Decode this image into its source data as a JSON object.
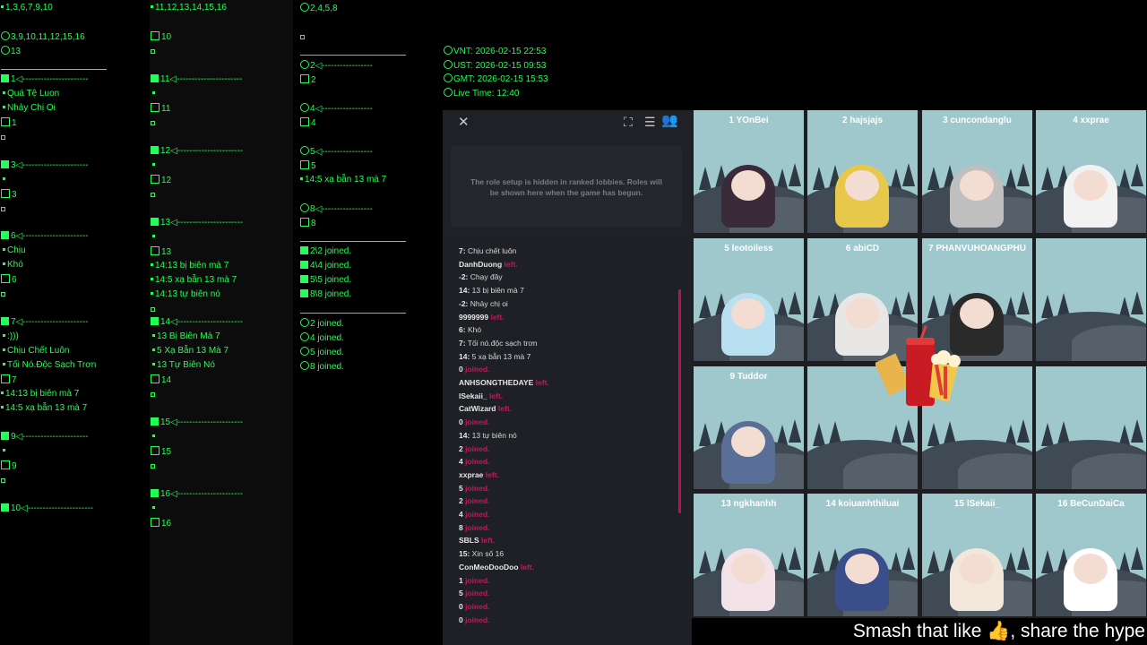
{
  "col1": {
    "header": "1,3,6,7,9,10",
    "list_line": "3,9,10,11,12,15,16",
    "count_line": "13",
    "sections": [
      {
        "id": "1",
        "lines": [
          "Quá Tệ Luon",
          "Nhảy Chị Oi"
        ],
        "box": "1"
      },
      {
        "id": "3",
        "lines": [],
        "box": "3"
      },
      {
        "id": "6",
        "lines": [
          "Chịu",
          "Khó"
        ],
        "box": "6"
      },
      {
        "id": "7",
        "lines": [
          ":)))",
          "Chịu Chết Luôn",
          "Tối Nó.Độc Sạch Trơn"
        ],
        "box": "7",
        "extra": [
          "14:13 bị biên mà 7",
          "14:5 xạ bẫn 13 mà 7"
        ]
      },
      {
        "id": "9",
        "lines": [],
        "box": "9"
      },
      {
        "id": "10",
        "lines": [],
        "box": ""
      }
    ]
  },
  "col2": {
    "header": "11,12,13,14,15,16",
    "box10": "10",
    "sections": [
      {
        "id": "11",
        "box": "11",
        "lines": []
      },
      {
        "id": "12",
        "box": "12",
        "lines": []
      },
      {
        "id": "13",
        "box": "13",
        "lines": [
          "14:13 bị biên mà 7",
          "14:5 xạ bẫn 13 mà 7",
          "14:13 tự biên nó"
        ]
      },
      {
        "id": "14",
        "box": "14",
        "lines": [
          "13 Bị Biên Mà 7",
          "5 Xạ Bẫn 13 Mà 7",
          "13 Tự Biên Nó"
        ]
      },
      {
        "id": "15",
        "box": "15",
        "lines": []
      },
      {
        "id": "16",
        "box": "16",
        "lines": []
      }
    ]
  },
  "col3": {
    "header": "2,4,5,8",
    "sections": [
      {
        "id": "2",
        "box": "2",
        "lines": []
      },
      {
        "id": "4",
        "box": "4",
        "lines": []
      },
      {
        "id": "5",
        "box": "5",
        "lines": [
          "14:5 xạ bẫn 13 mà 7"
        ]
      },
      {
        "id": "8",
        "box": "8",
        "lines": []
      }
    ],
    "joined_filled": [
      "2\\2 joined.",
      "4\\4 joined.",
      "5\\5 joined.",
      "8\\8 joined."
    ],
    "joined_icon": [
      "2 joined.",
      "4 joined.",
      "5 joined.",
      "8 joined."
    ]
  },
  "times": {
    "vnt": "VNT: 2026-02-15 22:53",
    "ust": "UST: 2026-02-15 09:53",
    "gmt": "GMT: 2026-02-15 15:53",
    "live": "Live Time: 12:40"
  },
  "sidebar": {
    "role_text": "The role setup is hidden in ranked lobbies. Roles will be shown here when the game has begun."
  },
  "chat": [
    {
      "name": "7:",
      "text": "Chịu chết luôn",
      "ev": ""
    },
    {
      "name": "DanhDuong",
      "text": "",
      "ev": "left."
    },
    {
      "name": "-2:",
      "text": "Chạy đây",
      "ev": ""
    },
    {
      "name": "14:",
      "text": "13 bị biên mà 7",
      "ev": ""
    },
    {
      "name": "-2:",
      "text": "Nhảy chị oi",
      "ev": ""
    },
    {
      "name": "9999999",
      "text": "",
      "ev": "left."
    },
    {
      "name": "6:",
      "text": "Khó",
      "ev": ""
    },
    {
      "name": "7:",
      "text": "Tối nó.độc sạch trơn",
      "ev": ""
    },
    {
      "name": "14:",
      "text": "5 xạ bẫn 13 mà 7",
      "ev": ""
    },
    {
      "name": "0",
      "text": "",
      "ev": "joined."
    },
    {
      "name": "ANHSONGTHEDAYE",
      "text": "",
      "ev": "left."
    },
    {
      "name": "lSekaii_",
      "text": "",
      "ev": "left."
    },
    {
      "name": "CatWizard",
      "text": "",
      "ev": "left."
    },
    {
      "name": "0",
      "text": "",
      "ev": "joined."
    },
    {
      "name": "14:",
      "text": "13 tự biên nó",
      "ev": ""
    },
    {
      "name": "2",
      "text": "",
      "ev": "joined."
    },
    {
      "name": "4",
      "text": "",
      "ev": "joined."
    },
    {
      "name": "xxprae",
      "text": "",
      "ev": "left."
    },
    {
      "name": "5",
      "text": "",
      "ev": "joined."
    },
    {
      "name": "2",
      "text": "",
      "ev": "joined."
    },
    {
      "name": "4",
      "text": "",
      "ev": "joined."
    },
    {
      "name": "8",
      "text": "",
      "ev": "joined."
    },
    {
      "name": "SBLS",
      "text": "",
      "ev": "left."
    },
    {
      "name": "15:",
      "text": "Xin số 16",
      "ev": ""
    },
    {
      "name": "ConMeoDooDoo",
      "text": "",
      "ev": "left."
    },
    {
      "name": "1",
      "text": "",
      "ev": "joined."
    },
    {
      "name": "5",
      "text": "",
      "ev": "joined."
    },
    {
      "name": "0",
      "text": "",
      "ev": "joined."
    },
    {
      "name": "0",
      "text": "",
      "ev": "joined."
    }
  ],
  "players": [
    {
      "label": "1 YOnBei",
      "color": "#3a2a3a"
    },
    {
      "label": "2 hajsjajs",
      "color": "#e8c84a"
    },
    {
      "label": "3 cuncondanglu",
      "color": "#bfbfbf"
    },
    {
      "label": "4 xxprae",
      "color": "#f2f2f2"
    },
    {
      "label": "5 leotoiless",
      "color": "#b8e0f0"
    },
    {
      "label": "6 abiCD",
      "color": "#e9e6e6"
    },
    {
      "label": "7 PHANVUHOANGPHU",
      "color": "#2a2a2a"
    },
    {
      "label": "",
      "color": ""
    },
    {
      "label": "9 Tuddor",
      "color": "#5a6f98"
    },
    {
      "label": "",
      "color": ""
    },
    {
      "label": "",
      "color": ""
    },
    {
      "label": "",
      "color": ""
    },
    {
      "label": "13 ngkhanhh",
      "color": "#f3e3e8"
    },
    {
      "label": "14 koiuanhthiluai",
      "color": "#3a4f8a"
    },
    {
      "label": "15 lSekaii_",
      "color": "#f2e7da"
    },
    {
      "label": "16 BeCunDaiCa",
      "color": "#ffffff"
    }
  ],
  "banner": {
    "pre": "Smash that like ",
    "post": ", share the hype"
  },
  "icons": {
    "close": "close-icon",
    "expand": "expand-icon",
    "list": "list-icon",
    "players": "players-icon",
    "like": "thumbs-up-icon"
  }
}
